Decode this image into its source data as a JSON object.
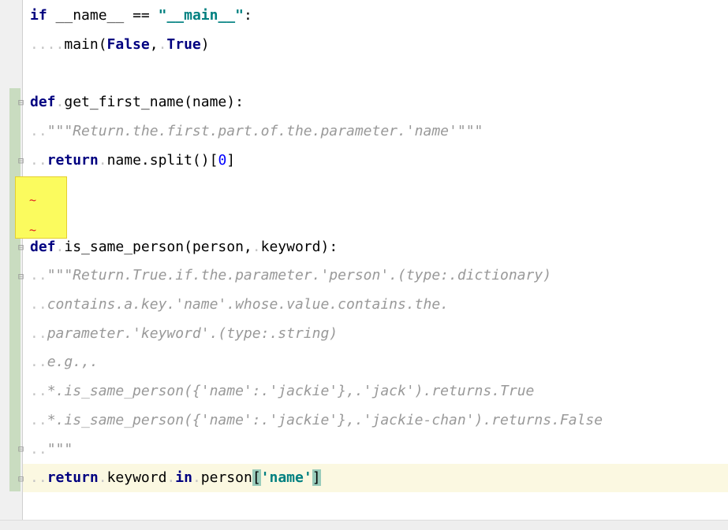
{
  "editor": {
    "lines": [
      {
        "tokens": [
          {
            "t": "if",
            "c": "kw"
          },
          {
            "t": " ",
            "c": "ws"
          },
          {
            "t": "__name__",
            "c": ""
          },
          {
            "t": " ",
            "c": "ws"
          },
          {
            "t": "==",
            "c": ""
          },
          {
            "t": " ",
            "c": "ws"
          },
          {
            "t": "\"__main__\"",
            "c": "str"
          },
          {
            "t": ":",
            "c": ""
          }
        ]
      },
      {
        "tokens": [
          {
            "t": "....",
            "c": "ws"
          },
          {
            "t": "main(",
            "c": ""
          },
          {
            "t": "False",
            "c": "kw"
          },
          {
            "t": ",",
            "c": ""
          },
          {
            "t": ".",
            "c": "ws"
          },
          {
            "t": "True",
            "c": "kw"
          },
          {
            "t": ")",
            "c": ""
          }
        ]
      },
      {
        "tokens": []
      },
      {
        "tokens": [
          {
            "t": "def",
            "c": "kw"
          },
          {
            "t": ".",
            "c": "ws"
          },
          {
            "t": "get_first_name(name):",
            "c": ""
          }
        ]
      },
      {
        "tokens": [
          {
            "t": "..",
            "c": "ws"
          },
          {
            "t": "\"\"\"Return.the.first.part.of.the.parameter.'name'\"\"\"",
            "c": "doc"
          }
        ]
      },
      {
        "tokens": [
          {
            "t": "..",
            "c": "ws"
          },
          {
            "t": "return",
            "c": "kw"
          },
          {
            "t": ".",
            "c": "ws"
          },
          {
            "t": "name.split()[",
            "c": ""
          },
          {
            "t": "0",
            "c": "num"
          },
          {
            "t": "]",
            "c": ""
          }
        ]
      },
      {
        "tokens": []
      },
      {
        "tokens": []
      },
      {
        "tokens": [
          {
            "t": "def",
            "c": "kw"
          },
          {
            "t": ".",
            "c": "ws"
          },
          {
            "t": "is_same_person(person,",
            "c": ""
          },
          {
            "t": ".",
            "c": "ws"
          },
          {
            "t": "keyword):",
            "c": ""
          }
        ]
      },
      {
        "tokens": [
          {
            "t": "..",
            "c": "ws"
          },
          {
            "t": "\"\"\"Return.True.if.the.parameter.'person'.(type:.dictionary)",
            "c": "doc"
          }
        ]
      },
      {
        "tokens": [
          {
            "t": "..",
            "c": "ws"
          },
          {
            "t": "contains.a.key.'name'.whose.value.contains.the.",
            "c": "doc"
          }
        ]
      },
      {
        "tokens": [
          {
            "t": "..",
            "c": "ws"
          },
          {
            "t": "parameter.'keyword'.(type:.string)",
            "c": "doc"
          }
        ]
      },
      {
        "tokens": [
          {
            "t": "..",
            "c": "ws"
          },
          {
            "t": "e.g.,.",
            "c": "doc"
          }
        ]
      },
      {
        "tokens": [
          {
            "t": "..",
            "c": "ws"
          },
          {
            "t": "*.is_same_person({'name':.'jackie'},.'jack').returns.True",
            "c": "doc"
          }
        ]
      },
      {
        "tokens": [
          {
            "t": "..",
            "c": "ws"
          },
          {
            "t": "*.is_same_person({'name':.'jackie'},.'jackie-chan').returns.False",
            "c": "doc"
          }
        ]
      },
      {
        "tokens": [
          {
            "t": "..",
            "c": "ws"
          },
          {
            "t": "\"\"\"",
            "c": "doc"
          }
        ]
      },
      {
        "tokens": [
          {
            "t": "..",
            "c": "ws"
          },
          {
            "t": "return",
            "c": "kw"
          },
          {
            "t": ".",
            "c": "ws"
          },
          {
            "t": "keyword",
            "c": ""
          },
          {
            "t": ".",
            "c": "ws"
          },
          {
            "t": "in",
            "c": "kw"
          },
          {
            "t": ".",
            "c": "ws"
          },
          {
            "t": "person",
            "c": ""
          },
          {
            "t": "[",
            "c": "match"
          },
          {
            "t": "'name'",
            "c": "sstr"
          },
          {
            "t": "]",
            "c": "match"
          }
        ]
      }
    ],
    "warnings": [
      "~",
      "~"
    ],
    "colors": {
      "keyword": "#000080",
      "string": "#008080",
      "docstring": "#999999",
      "number": "#0000ff",
      "whitespace": "#c4c4c4",
      "warning_bg": "#fbfb5e",
      "current_line": "#fbf8e1",
      "bracket_match": "#99ccbb"
    },
    "icons": {
      "fold_start": "fold-start-icon",
      "fold_end": "fold-end-icon"
    }
  }
}
